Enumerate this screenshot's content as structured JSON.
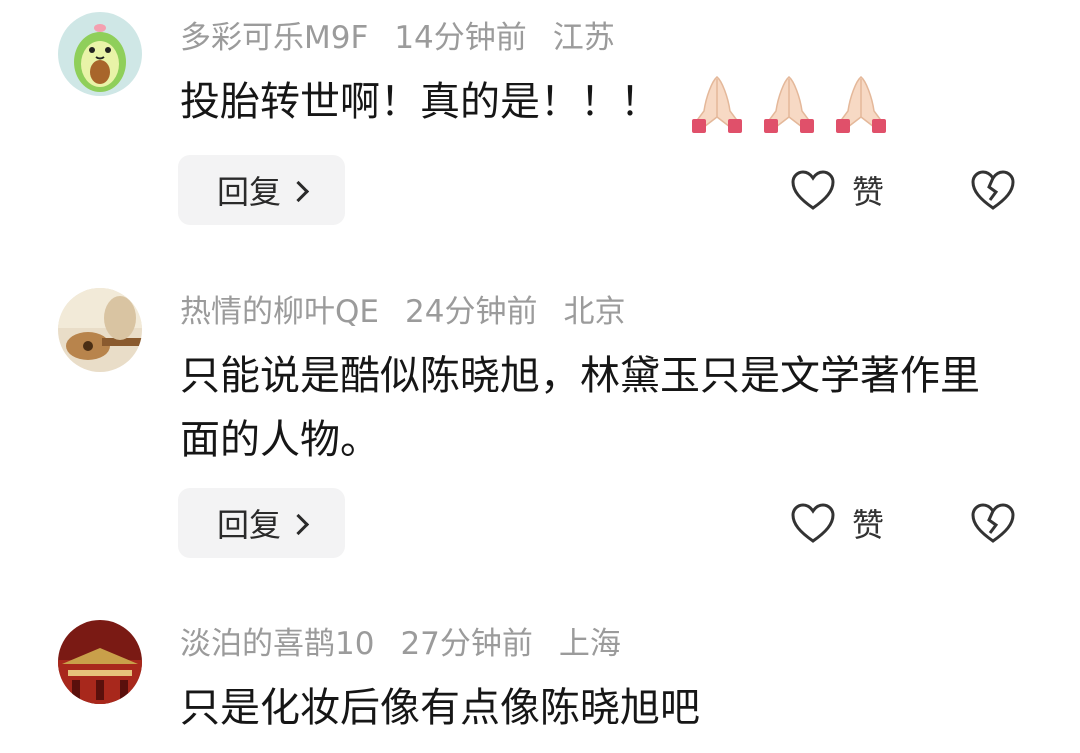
{
  "comments": [
    {
      "username": "多彩可乐M9F",
      "time": "14分钟前",
      "location": "江苏",
      "text": "投胎转世啊！真的是！！！",
      "avatar_icon": "avocado-avatar",
      "emojis": [
        "folded-hands-icon",
        "folded-hands-icon",
        "folded-hands-icon"
      ],
      "reply_label": "回复",
      "like_label": "赞"
    },
    {
      "username": "热情的柳叶QE",
      "time": "24分钟前",
      "location": "北京",
      "text": "只能说是酷似陈晓旭，林黛玉只是文学著作里面的人物。",
      "avatar_icon": "guitar-photo-avatar",
      "reply_label": "回复",
      "like_label": "赞"
    },
    {
      "username": "淡泊的喜鹊10",
      "time": "27分钟前",
      "location": "上海",
      "text": "只是化妆后像有点像陈晓旭吧",
      "avatar_icon": "palace-photo-avatar"
    }
  ],
  "colors": {
    "meta_text": "#9b9b9b",
    "body_text": "#161616",
    "reply_bg": "#f3f3f4"
  }
}
